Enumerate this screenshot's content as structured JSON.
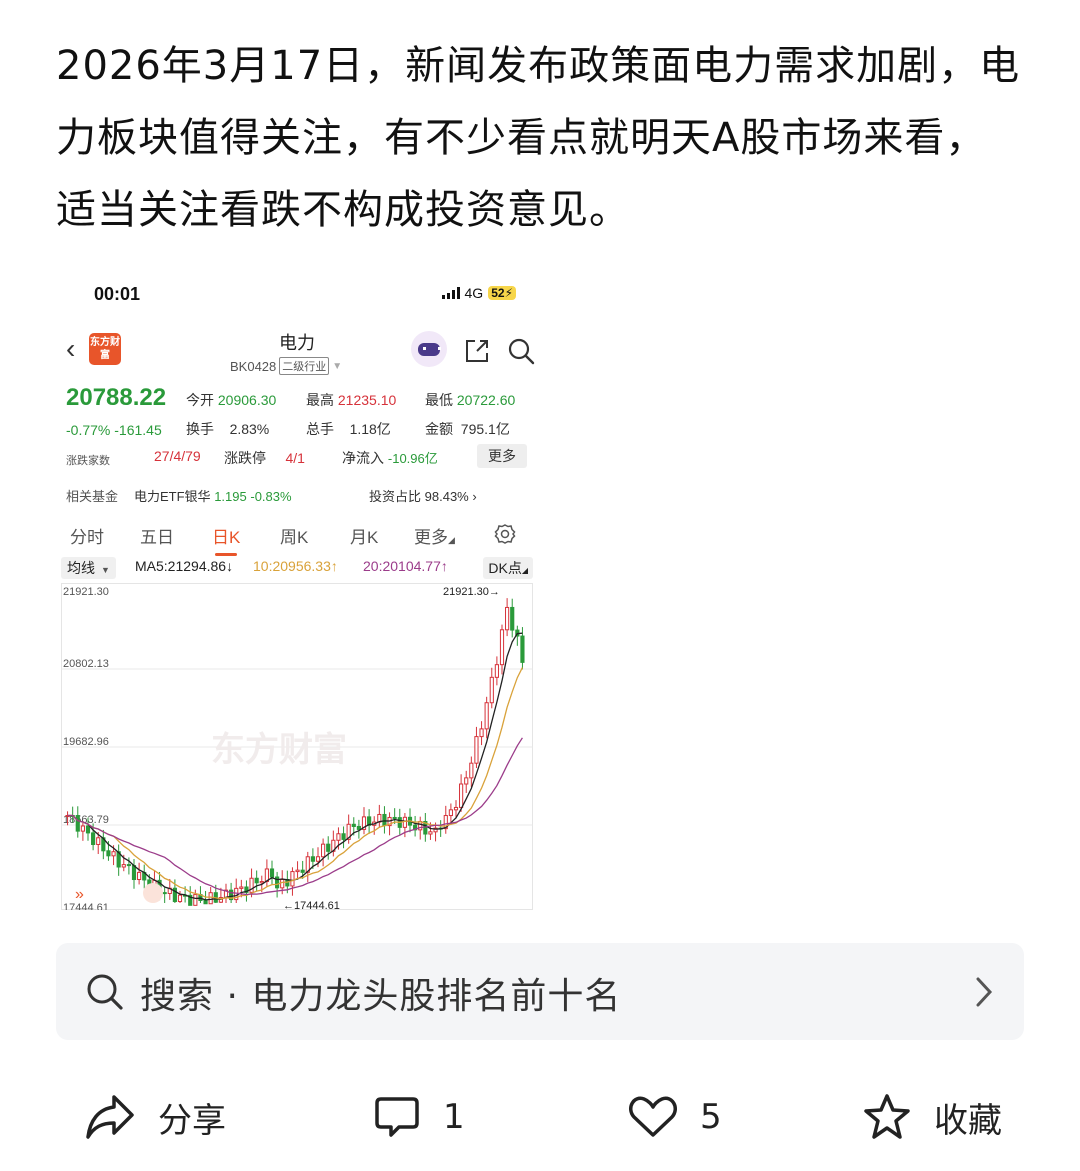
{
  "post": {
    "text": "2026年3月17日，新闻发布政策面电力需求加剧，电力板块值得关注，有不少看点就明天A股市场来看，适当关注看跌不构成投资意见。"
  },
  "screenshot": {
    "status_bar": {
      "time": "00:01",
      "network": "4G",
      "battery": "52"
    },
    "header": {
      "logo_text": "东方财富",
      "title": "电力",
      "code": "BK0428",
      "tag": "二级行业"
    },
    "quote": {
      "price": "20788.22",
      "change_pct": "-0.77%",
      "change_abs": "-161.45",
      "open_label": "今开",
      "open": "20906.30",
      "high_label": "最高",
      "high": "21235.10",
      "low_label": "最低",
      "low": "20722.60",
      "turnover_label": "换手",
      "turnover": "2.83%",
      "volume_label": "总手",
      "volume": "1.18亿",
      "amount_label": "金额",
      "amount": "795.1亿",
      "updown_label": "涨跌家数",
      "updown": "27/4/79",
      "limit_label": "涨跌停",
      "limit": "4/1",
      "inflow_label": "净流入",
      "inflow": "-10.96亿",
      "more_label": "更多"
    },
    "fund": {
      "label": "相关基金",
      "name": "电力ETF银华",
      "price": "1.195",
      "change": "-0.83%",
      "ratio_label": "投资占比",
      "ratio": "98.43%"
    },
    "tabs": [
      "分时",
      "五日",
      "日K",
      "周K",
      "月K",
      "更多"
    ],
    "active_tab": "日K",
    "ma": {
      "selector": "均线",
      "ma5": "MA5:21294.86↓",
      "ma10": "10:20956.33↑",
      "ma20": "20:20104.77↑",
      "dk": "DK点"
    },
    "colors": {
      "up": "#d6323a",
      "down": "#2a9a3a",
      "ma5": "#222222",
      "ma10": "#d9a23a",
      "ma20": "#9b3c8a",
      "accent": "#e8552a"
    }
  },
  "chart_data": {
    "type": "candlestick",
    "y_labels": [
      "21921.30",
      "20802.13",
      "19682.96",
      "18563.79",
      "17444.61"
    ],
    "ylim": [
      17444.61,
      21921.3
    ],
    "high_marker": "21921.30",
    "low_marker": "17444.61",
    "watermark": "东方财富"
  },
  "search": {
    "prefix": "搜索",
    "dot": "·",
    "query": "电力龙头股排名前十名"
  },
  "actions": {
    "share": "分享",
    "comments": "1",
    "likes": "5",
    "favorite": "收藏"
  }
}
